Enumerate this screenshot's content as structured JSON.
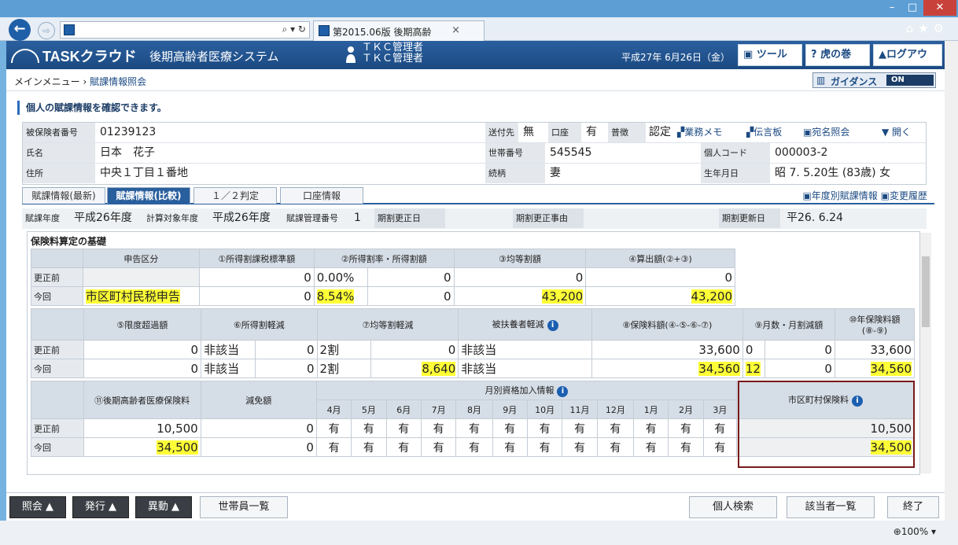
{
  "browser": {
    "address": "",
    "tab_title": "第2015.06版 後期高齢",
    "address_icons": "⌕ ▾ ↻",
    "win_min": "–",
    "win_max": "□",
    "win_close": "✕",
    "ie_icons": "⌂★⚙",
    "back": "←",
    "fwd": "⇨",
    "tab_close": "×",
    "zoom": "100%",
    "zoom_arrow": "▾"
  },
  "app": {
    "logo": "TASKクラウド",
    "system_name": "後期高齢者医療システム",
    "user_line1": "ＴＫＣ管理者",
    "user_line2": "ＴＫＣ管理者",
    "date": "平成27年 6月26日（金）",
    "tool_btn": "ツール",
    "tora_btn": "虎の巻",
    "logout_btn": "ログアウト",
    "tool_icon": "▣",
    "tora_icon": "?",
    "logout_icon": "▲"
  },
  "breadcrumb": {
    "home": "メインメニュー",
    "sep": "›",
    "current": "賦課情報照会"
  },
  "guidance": {
    "label": "ガイダンス",
    "state": "ON"
  },
  "message": "個人の賦課情報を確認できます。",
  "person": {
    "ins_no_label": "被保険者番号",
    "ins_no": "01239123",
    "name_label": "氏名",
    "name": "日本　花子",
    "addr_label": "住所",
    "addr": "中央１丁目１番地",
    "send_label": "送付先",
    "send": "無",
    "account_label": "口座",
    "account": "有",
    "collect_label": "普徴",
    "collect": "認定",
    "link_memo": "業務メモ",
    "link_board": "伝言板",
    "link_addr": "宛名照会",
    "link_open": "▼ 開く",
    "household_label": "世帯番号",
    "household": "545545",
    "relation_label": "続柄",
    "relation": "妻",
    "personal_code_label": "個人コード",
    "personal_code": "000003-2",
    "birth_label": "生年月日",
    "birth": "昭 7. 5.20生 (83歳) 女"
  },
  "tabs": [
    "賦課情報(最新)",
    "賦課情報(比較)",
    "１／２判定",
    "口座情報"
  ],
  "tab_links": {
    "yearly": "年度別賦課情報",
    "history": "変更履歴"
  },
  "year_row": {
    "fy_label": "賦課年度",
    "fy": "平成26年度",
    "target_label": "計算対象年度",
    "target": "平成26年度",
    "mgmt_label": "賦課管理番号",
    "mgmt": "1",
    "revise_date_label": "期割更正日",
    "revise_reason_label": "期割更正事由",
    "update_label": "期割更新日",
    "update": "平26. 6.24"
  },
  "section": {
    "title": "保険料算定の基礎",
    "t1_headers": [
      "申告区分",
      "①所得割課税標準額",
      "②所得割率・所得割額",
      "③均等割額",
      "④算出額(②+③)"
    ],
    "rows": [
      "更正前",
      "今回"
    ],
    "t1_before": [
      "",
      "0",
      "0.00%",
      "0",
      "0",
      "0"
    ],
    "t1_now": [
      "市区町村民税申告",
      "0",
      "8.54%",
      "0",
      "43,200",
      "43,200"
    ],
    "t2_headers": [
      "⑤限度超過額",
      "⑥所得割軽減",
      "⑦均等割軽減",
      "被扶養者軽減",
      "⑧保険料額(④-⑤-⑥-⑦)",
      "⑨月数・月割減額",
      "⑩年保険料額",
      "(⑧-⑨)"
    ],
    "t2_before": [
      "0",
      "非該当",
      "0",
      "2割",
      "0",
      "非該当",
      "33,600",
      "0",
      "0",
      "33,600"
    ],
    "t2_now": [
      "0",
      "非該当",
      "0",
      "2割",
      "8,640",
      "非該当",
      "34,560",
      "12",
      "0",
      "34,560"
    ],
    "t3_headers": [
      "⑪後期高齢者医療保険料",
      "減免額",
      "月別資格加入情報",
      "市区町村保険料"
    ],
    "months": [
      "4月",
      "5月",
      "6月",
      "7月",
      "8月",
      "9月",
      "10月",
      "11月",
      "12月",
      "1月",
      "2月",
      "3月"
    ],
    "t3_before": [
      "10,500",
      "0",
      "10,500"
    ],
    "t3_now": [
      "34,500",
      "0",
      "34,500"
    ],
    "month_values_before": [
      "有",
      "有",
      "有",
      "有",
      "有",
      "有",
      "有",
      "有",
      "有",
      "有",
      "有",
      "有"
    ],
    "month_values_now": [
      "有",
      "有",
      "有",
      "有",
      "有",
      "有",
      "有",
      "有",
      "有",
      "有",
      "有",
      "有"
    ],
    "info_mark": "i"
  },
  "footer": {
    "inquiry": "照会 ▲",
    "issue": "発行 ▲",
    "change": "異動 ▲",
    "household_list": "世帯員一覧",
    "person_search": "個人検索",
    "target_list": "該当者一覧",
    "end": "終了"
  }
}
